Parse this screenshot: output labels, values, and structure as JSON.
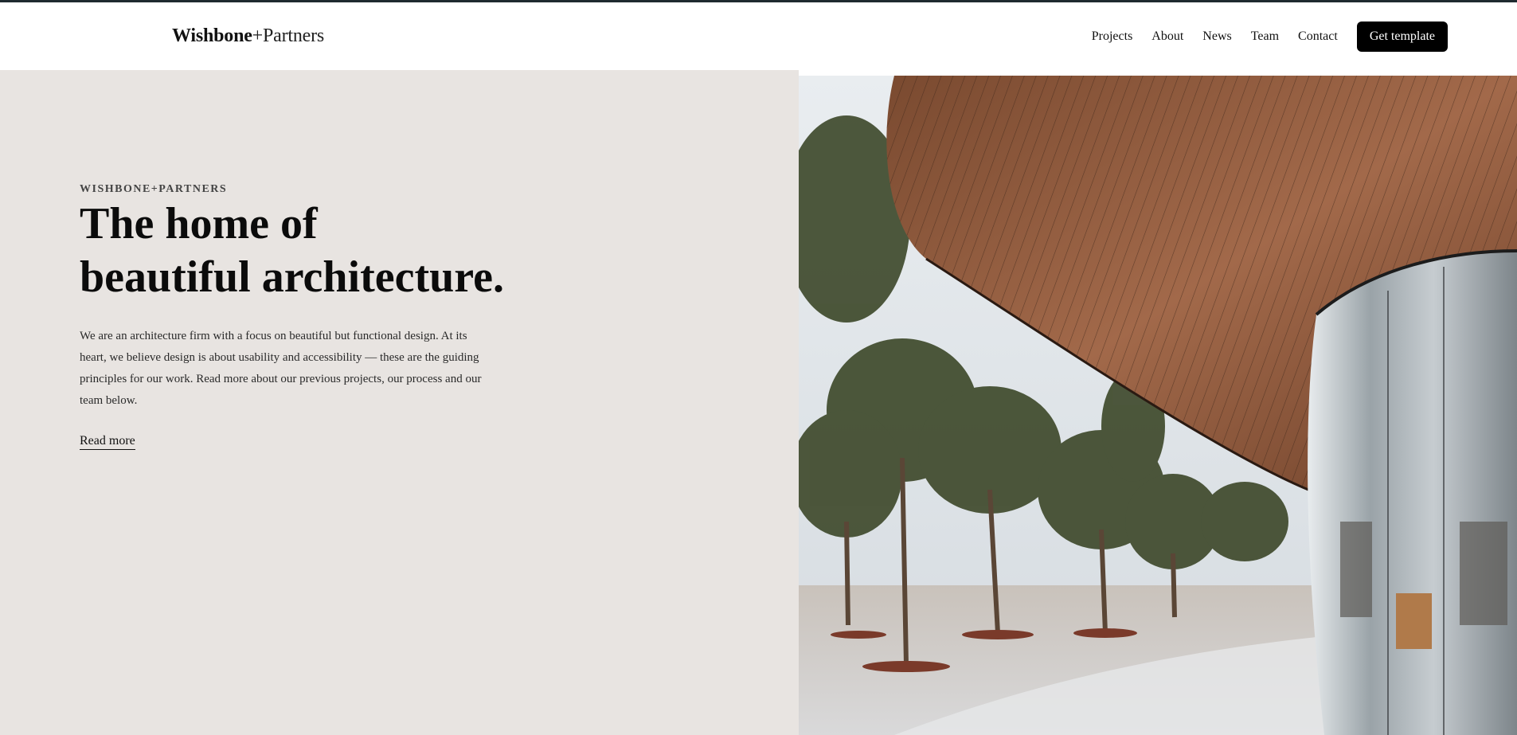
{
  "brand": {
    "name_bold": "Wishbone",
    "name_rest": "+Partners"
  },
  "nav": {
    "items": [
      "Projects",
      "About",
      "News",
      "Team",
      "Contact"
    ],
    "cta_label": "Get template"
  },
  "hero": {
    "eyebrow": "WISHBONE+PARTNERS",
    "headline_line1": "The home of",
    "headline_line2": "beautiful architecture.",
    "description": "We are an architecture firm with a focus on beautiful but functional design. At its heart, we believe design is about usability and accessibility — these are the guiding principles for our work. Read more about our previous projects, our process and our team below.",
    "link_label": "Read more"
  },
  "colors": {
    "hero_background": "#e8e4e1",
    "cta_background": "#000000",
    "top_bar": "#1f2a30"
  }
}
